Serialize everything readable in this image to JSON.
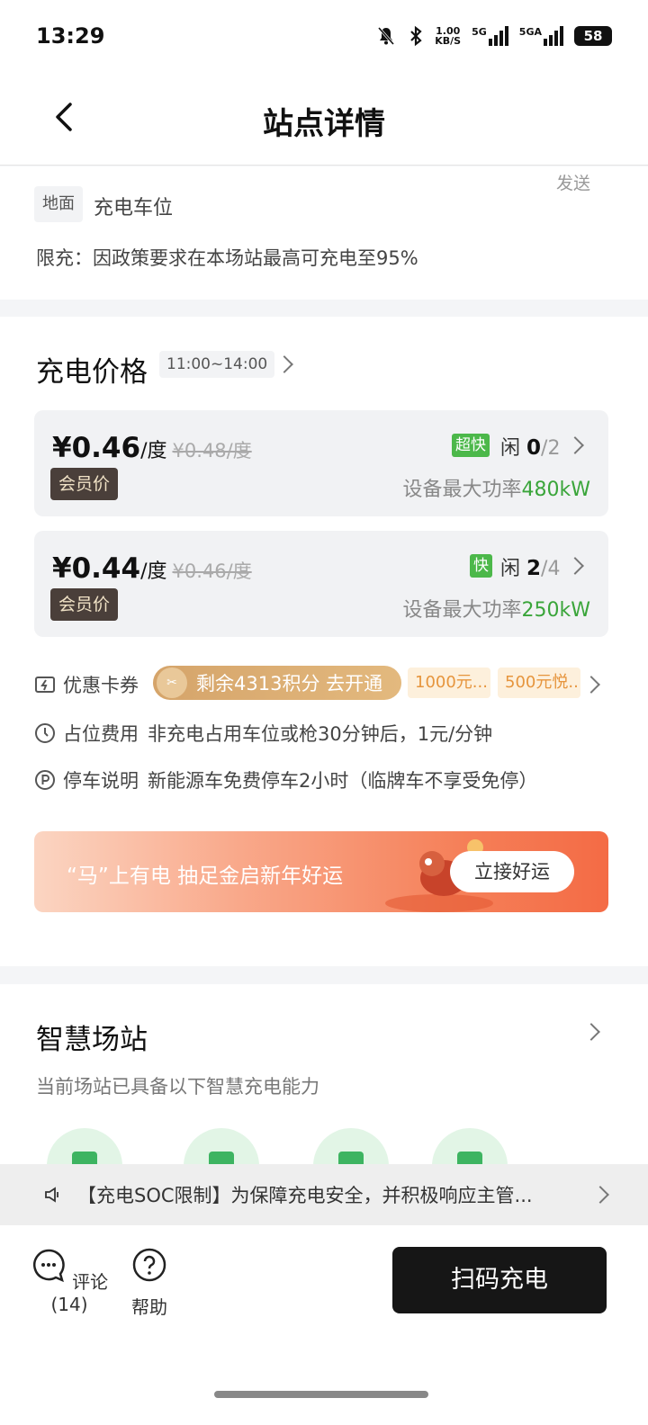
{
  "status_bar": {
    "time": "13:29",
    "network_speed": "1.00\nKB/S",
    "signal1": "5G",
    "signal2": "5GA",
    "battery": "58"
  },
  "header": {
    "title": "站点详情"
  },
  "station_info": {
    "send_label": "发送",
    "ground_tag": "地面",
    "ground_label": "充电车位",
    "limit_text": "限充：因政策要求在本场站最高可充电至95%"
  },
  "pricing": {
    "title": "充电价格",
    "time_range": "11:00~14:00",
    "items": [
      {
        "price": "¥0.46",
        "unit": "/度",
        "original": "¥0.48/度",
        "member_tag": "会员价",
        "speed_tag": "超快",
        "idle_label": "闲",
        "idle_count": "0",
        "total": "/2",
        "power_label": "设备最大功率",
        "power_value": "480kW"
      },
      {
        "price": "¥0.44",
        "unit": "/度",
        "original": "¥0.46/度",
        "member_tag": "会员价",
        "speed_tag": "快",
        "idle_label": "闲",
        "idle_count": "2",
        "total": "/4",
        "power_label": "设备最大功率",
        "power_value": "250kW"
      }
    ],
    "coupon": {
      "label": "优惠卡券",
      "pill_text": "剩余4313积分 去开通",
      "chips": [
        "1000元...",
        "500元悦.."
      ]
    },
    "occupancy": {
      "label": "占位费用",
      "text": "非充电占用车位或枪30分钟后，1元/分钟"
    },
    "parking": {
      "label": "停车说明",
      "text": "新能源车免费停车2小时（临牌车不享受免停）"
    },
    "banner": {
      "text": "“马”上有电 抽足金启新年好运",
      "button": "立接好运"
    }
  },
  "smart_station": {
    "title": "智慧场站",
    "subtitle": "当前场站已具备以下智慧充电能力"
  },
  "notice": {
    "text": "【充电SOC限制】为保障充电安全，并积极响应主管..."
  },
  "bottom_bar": {
    "comment_label": "评论(14)",
    "help_label": "帮助",
    "scan_button": "扫码充电"
  },
  "colors": {
    "accent_green": "#4cb84a",
    "power_green": "#3aa53a",
    "coupon_gold": "#d5a46a",
    "banner_orange": "#f57f58",
    "scan_button_bg": "#161616"
  }
}
